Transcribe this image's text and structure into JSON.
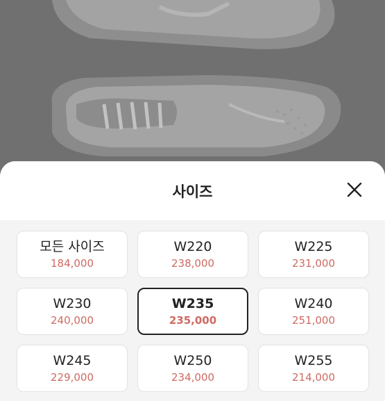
{
  "backdrop": {
    "image": "sneaker-pair-photo"
  },
  "sheet": {
    "title": "사이즈",
    "close_icon": "close-icon"
  },
  "sizes": [
    {
      "size": "모든 사이즈",
      "price": "184,000",
      "selected": false
    },
    {
      "size": "W220",
      "price": "238,000",
      "selected": false
    },
    {
      "size": "W225",
      "price": "231,000",
      "selected": false
    },
    {
      "size": "W230",
      "price": "240,000",
      "selected": false
    },
    {
      "size": "W235",
      "price": "235,000",
      "selected": true
    },
    {
      "size": "W240",
      "price": "251,000",
      "selected": false
    },
    {
      "size": "W245",
      "price": "229,000",
      "selected": false
    },
    {
      "size": "W250",
      "price": "234,000",
      "selected": false
    },
    {
      "size": "W255",
      "price": "214,000",
      "selected": false
    }
  ],
  "colors": {
    "price": "#cf6a62",
    "selected_border": "#222222",
    "overlay": "#707070"
  }
}
